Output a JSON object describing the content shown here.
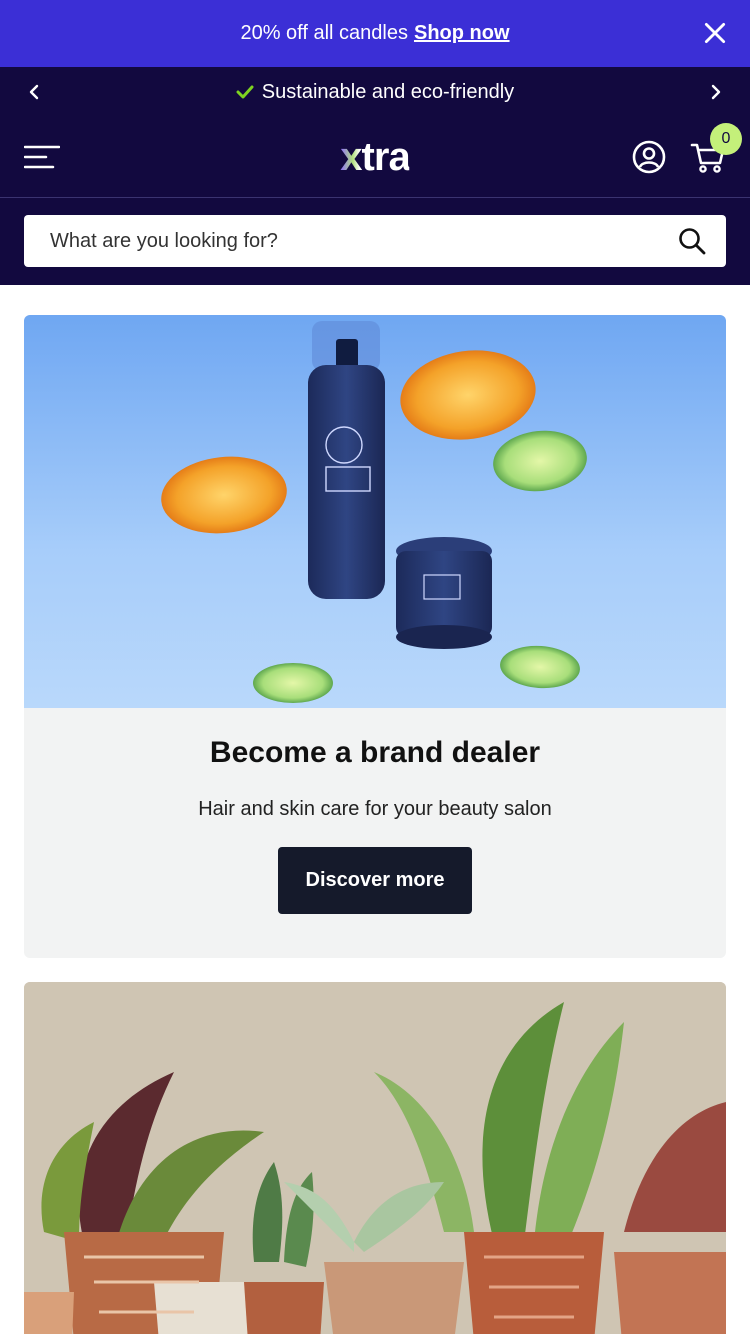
{
  "promo": {
    "text": "20% off all candles",
    "link": "Shop now",
    "close_icon": "close-icon"
  },
  "announcement": {
    "text": "Sustainable and eco-friendly",
    "check_icon": "check-icon",
    "prev_icon": "chevron-left-icon",
    "next_icon": "chevron-right-icon"
  },
  "header": {
    "logo": "xtra",
    "menu_icon": "hamburger-menu-icon",
    "account_icon": "user-account-icon",
    "cart_icon": "shopping-cart-icon",
    "cart_count": "0"
  },
  "search": {
    "placeholder": "What are you looking for?",
    "icon": "search-icon"
  },
  "hero_card": {
    "title": "Become a brand dealer",
    "subtitle": "Hair and skin care for your beauty salon",
    "button": "Discover more"
  },
  "colors": {
    "promo_bg": "#3b2fd6",
    "header_bg": "#12093f",
    "badge_bg": "#c4f07a",
    "button_bg": "#151a2b",
    "card_bg": "#f2f3f3",
    "check": "#7ed321"
  }
}
